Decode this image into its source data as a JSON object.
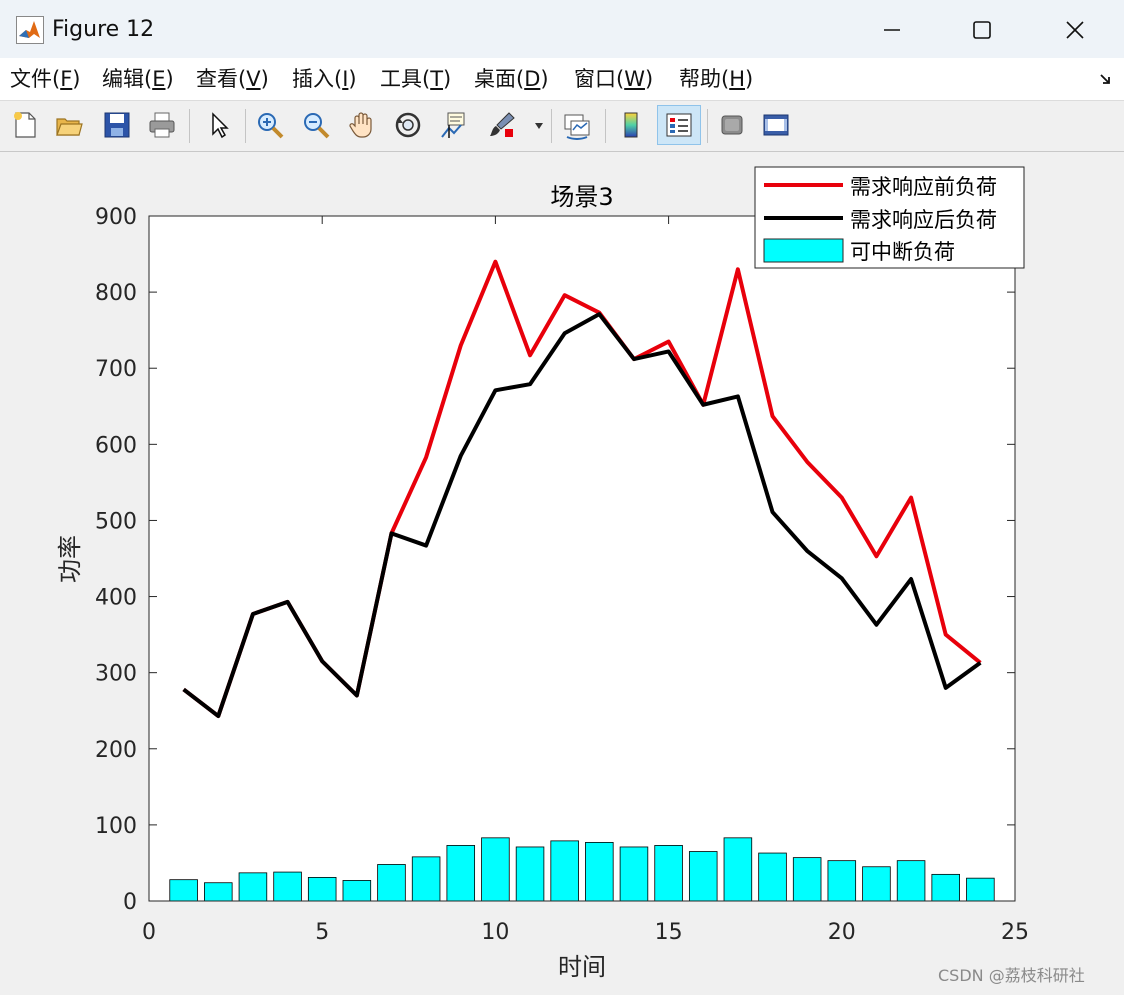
{
  "window": {
    "title": "Figure 12",
    "icon": "matlab-icon",
    "controls": [
      "minimize-icon",
      "maximize-icon",
      "close-icon"
    ]
  },
  "menu": [
    {
      "text": "文件(",
      "key": "F",
      "end": ")"
    },
    {
      "text": "编辑(",
      "key": "E",
      "end": ")"
    },
    {
      "text": "查看(",
      "key": "V",
      "end": ")"
    },
    {
      "text": "插入(",
      "key": "I",
      "end": ")"
    },
    {
      "text": "工具(",
      "key": "T",
      "end": ")"
    },
    {
      "text": "桌面(",
      "key": "D",
      "end": ")"
    },
    {
      "text": "窗口(",
      "key": "W",
      "end": ")"
    },
    {
      "text": "帮助(",
      "key": "H",
      "end": ")"
    }
  ],
  "toolbar": [
    "new-figure-icon",
    "open-file-icon",
    "save-icon",
    "print-icon",
    "pointer-icon",
    "zoom-in-icon",
    "zoom-out-icon",
    "pan-icon",
    "rotate-3d-icon",
    "data-cursor-icon",
    "brush-icon",
    "link-plot-icon",
    "colorbar-icon",
    "legend-icon",
    "hide-plot-tools-icon",
    "show-plot-tools-icon"
  ],
  "chart_data": {
    "type": "line",
    "title": "场景3",
    "xlabel": "时间",
    "ylabel": "功率",
    "xlim": [
      0,
      25
    ],
    "ylim": [
      0,
      900
    ],
    "xticks": [
      0,
      5,
      10,
      15,
      20,
      25
    ],
    "yticks": [
      0,
      100,
      200,
      300,
      400,
      500,
      600,
      700,
      800,
      900
    ],
    "legend_position": "top-right",
    "x": [
      1,
      2,
      3,
      4,
      5,
      6,
      7,
      8,
      9,
      10,
      11,
      12,
      13,
      14,
      15,
      16,
      17,
      18,
      19,
      20,
      21,
      22,
      23,
      24
    ],
    "series": [
      {
        "name": "需求响应前负荷",
        "kind": "line",
        "color": "#e8000b",
        "values": [
          278,
          243,
          377,
          393,
          315,
          270,
          483,
          583,
          730,
          840,
          717,
          796,
          773,
          712,
          735,
          652,
          830,
          637,
          577,
          530,
          453,
          530,
          350,
          313
        ]
      },
      {
        "name": "需求响应后负荷",
        "kind": "line",
        "color": "#000000",
        "values": [
          278,
          243,
          377,
          393,
          315,
          270,
          483,
          467,
          585,
          671,
          679,
          746,
          771,
          712,
          722,
          652,
          663,
          511,
          460,
          424,
          363,
          423,
          280,
          313
        ]
      },
      {
        "name": "可中断负荷",
        "kind": "bar",
        "color": "#00ffff",
        "values": [
          28,
          24,
          37,
          38,
          31,
          27,
          48,
          58,
          73,
          83,
          71,
          79,
          77,
          71,
          73,
          65,
          83,
          63,
          57,
          53,
          45,
          53,
          35,
          30
        ]
      }
    ]
  },
  "watermark": "CSDN @荔枝科研社"
}
